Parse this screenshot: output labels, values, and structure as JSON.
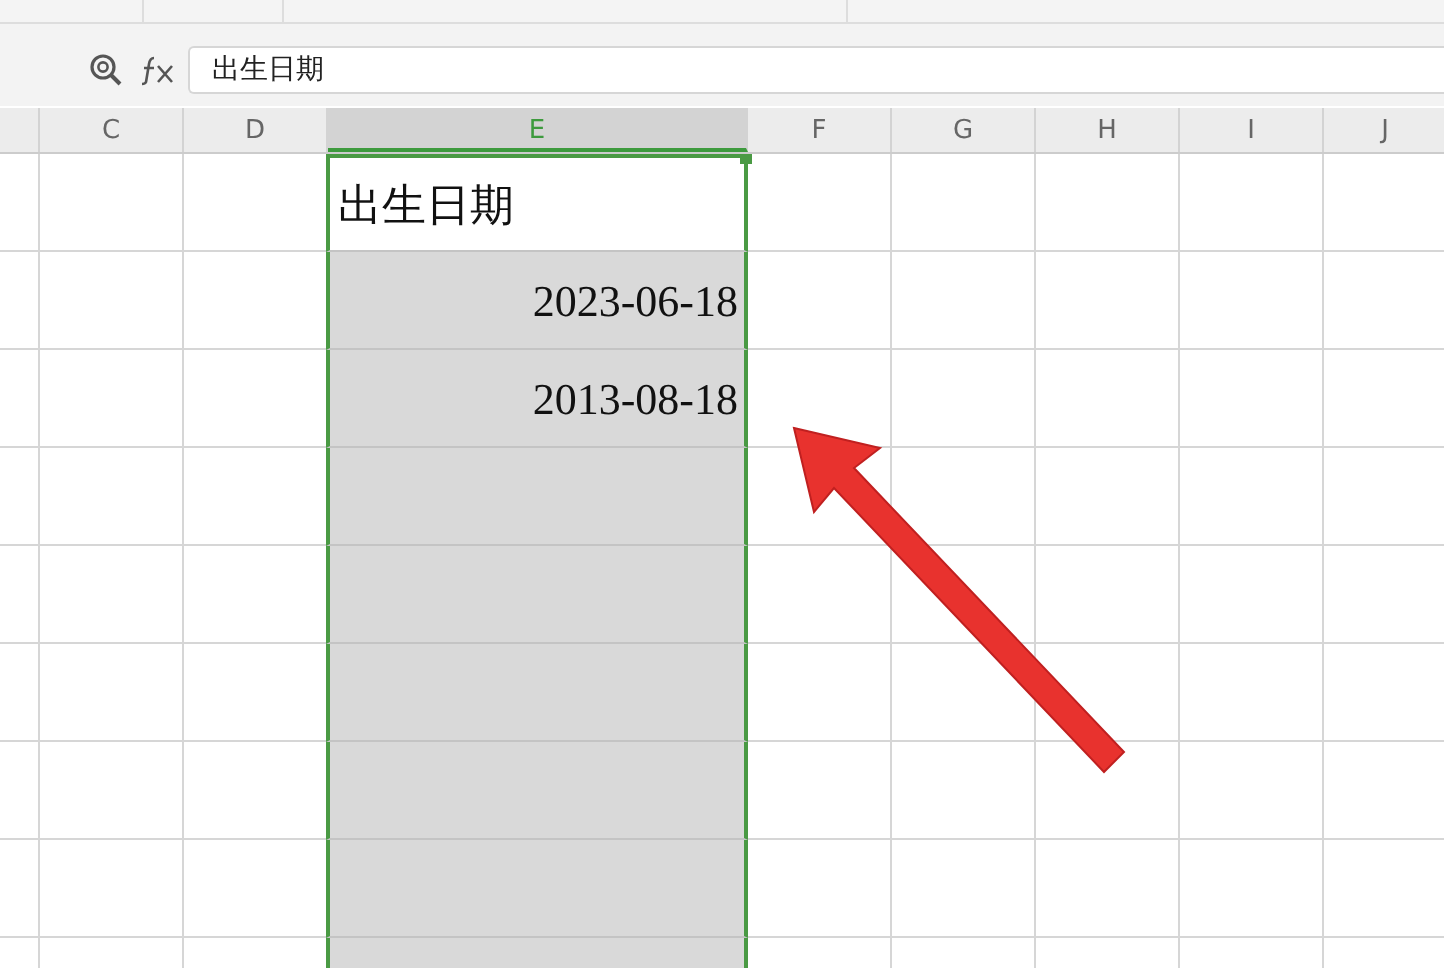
{
  "formula_bar": {
    "value": "出生日期"
  },
  "columns": [
    {
      "label": "C",
      "selected": false
    },
    {
      "label": "D",
      "selected": false
    },
    {
      "label": "E",
      "selected": true
    },
    {
      "label": "F",
      "selected": false
    },
    {
      "label": "G",
      "selected": false
    },
    {
      "label": "H",
      "selected": false
    },
    {
      "label": "I",
      "selected": false
    },
    {
      "label": "J",
      "selected": false
    }
  ],
  "selected_column_cells": [
    {
      "value": "出生日期",
      "kind": "text",
      "active": true
    },
    {
      "value": "2023-06-18",
      "kind": "date",
      "active": false
    },
    {
      "value": "2013-08-18",
      "kind": "date",
      "active": false
    }
  ]
}
